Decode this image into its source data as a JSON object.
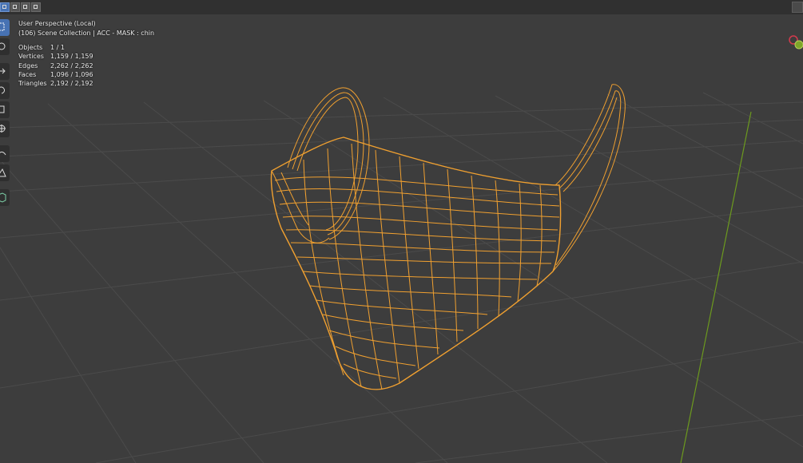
{
  "header": {
    "mode_buttons": [
      "vertex-select",
      "edge-select",
      "face-select",
      "xray"
    ]
  },
  "toolbar": {
    "tools": [
      "select-box-icon",
      "cursor-icon",
      "move-icon",
      "rotate-icon",
      "scale-icon",
      "transform-icon",
      "annotate-icon",
      "measure-icon",
      "add-cube-icon"
    ]
  },
  "overlay": {
    "view_name": "User Perspective (Local)",
    "collection": "(106) Scene Collection | ACC - MASK : chin",
    "stats": [
      {
        "label": "Objects",
        "value": "1 / 1"
      },
      {
        "label": "Vertices",
        "value": "1,159 / 1,159"
      },
      {
        "label": "Edges",
        "value": "2,262 / 2,262"
      },
      {
        "label": "Faces",
        "value": "1,096 / 1,096"
      },
      {
        "label": "Triangles",
        "value": "2,192 / 2,192"
      }
    ]
  },
  "colors": {
    "background": "#3d3d3d",
    "grid": "#4a4a4a",
    "wire": "#f0a030",
    "y_axis": "#6c9a1e",
    "accent": "#4772b3"
  }
}
